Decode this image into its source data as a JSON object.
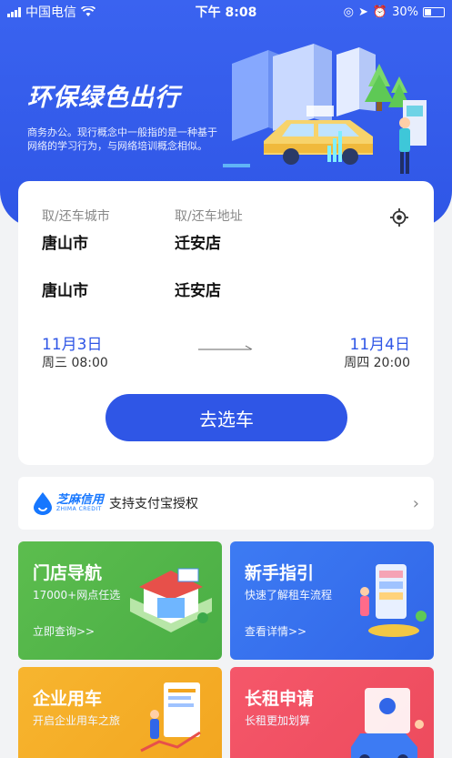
{
  "status_bar": {
    "carrier": "中国电信",
    "time": "下午 8:08",
    "battery": "30%"
  },
  "hero": {
    "title": "环保绿色出行",
    "description": "商务办公。现行概念中一般指的是一种基于网络的学习行为，与网络培训概念相似。"
  },
  "booking": {
    "city_label": "取/还车城市",
    "address_label": "取/还车地址",
    "pickup_city": "唐山市",
    "pickup_store": "迁安店",
    "return_city": "唐山市",
    "return_store": "迁安店",
    "pickup_date": "11月3日",
    "pickup_time": "周三 08:00",
    "return_date": "11月4日",
    "return_time": "周四 20:00",
    "go_button": "去选车"
  },
  "zhima": {
    "brand": "芝麻信用",
    "brand_en": "ZHIMA CREDIT",
    "text": "支持支付宝授权"
  },
  "tiles": [
    {
      "title": "门店导航",
      "subtitle": "17000+网点任选",
      "link": "立即查询>>"
    },
    {
      "title": "新手指引",
      "subtitle": "快速了解租车流程",
      "link": "查看详情>>"
    },
    {
      "title": "企业用车",
      "subtitle": "开启企业用车之旅",
      "link": ""
    },
    {
      "title": "长租申请",
      "subtitle": "长租更加划算",
      "link": ""
    }
  ],
  "colors": {
    "primary": "#2f56e6",
    "green": "#4aae45",
    "blue": "#3166e8",
    "orange": "#f2a51f",
    "red": "#ec4a5c"
  }
}
